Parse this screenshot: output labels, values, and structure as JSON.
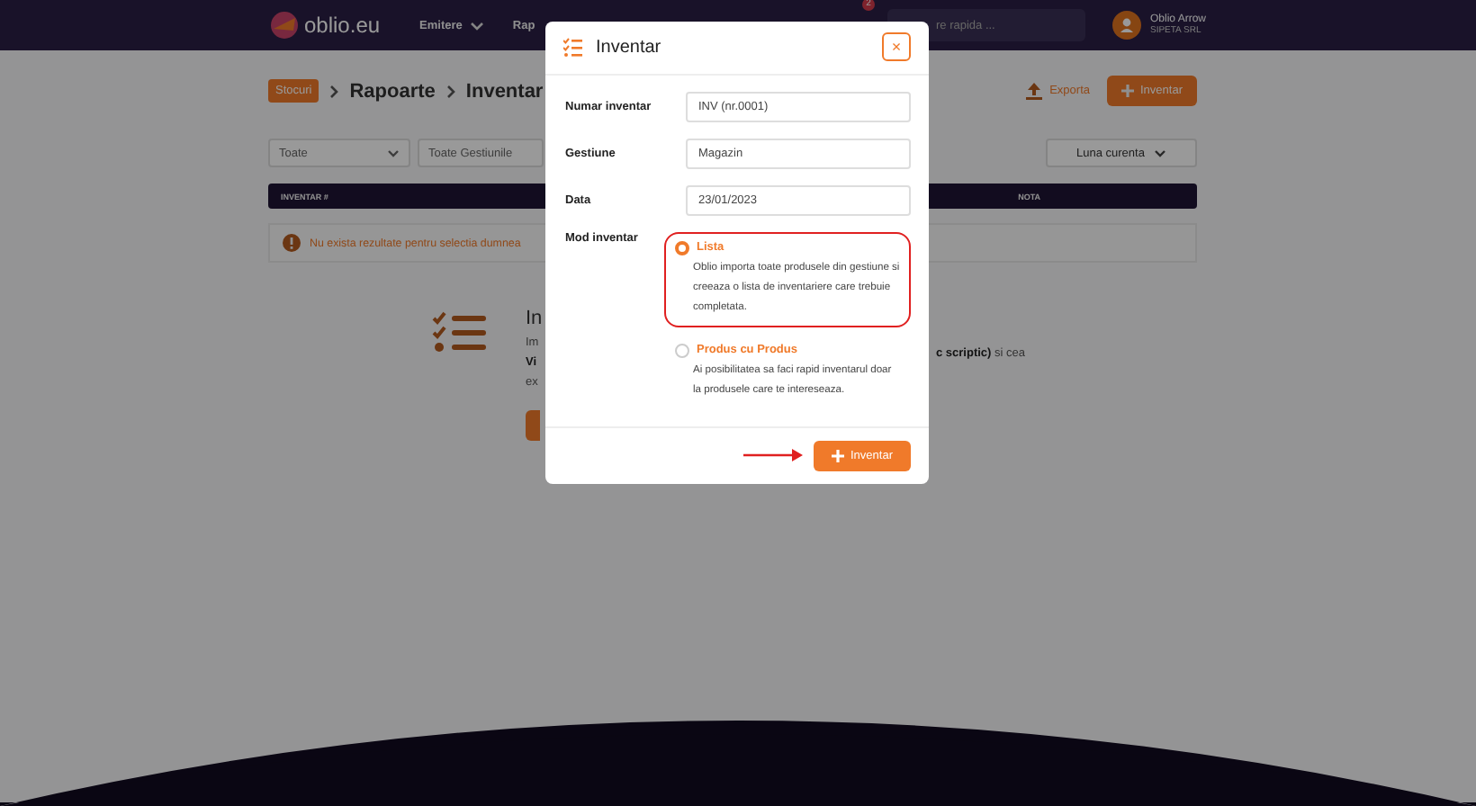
{
  "topbar": {
    "logo": "oblio.eu",
    "menu": [
      {
        "label": "Emitere",
        "caret": true
      },
      {
        "label": "Rap",
        "caret": false
      }
    ],
    "notification_count": "2",
    "search": {
      "placeholder": "re rapida ..."
    },
    "user": {
      "name": "Oblio Arrow",
      "company": "SIPETA SRL"
    }
  },
  "breadcrumb": {
    "tag": "Stocuri",
    "items": [
      "Rapoarte",
      "Inventar"
    ]
  },
  "actions": {
    "export": "Exporta",
    "add": "Inventar"
  },
  "filters": {
    "selects": [
      "Toate",
      "Toate Gestiunile"
    ],
    "period": "Luna curenta"
  },
  "table": {
    "columns": [
      "INVENTAR #",
      "NOTA"
    ]
  },
  "alert": {
    "text": "Nu exista rezultate pentru selectia dumnea"
  },
  "empty_state": {
    "title": "In",
    "lines": [
      "Im",
      "Vi",
      "ex"
    ],
    "right_text": "**c scriptic)** si cea"
  },
  "modal": {
    "title": "Inventar",
    "close": "×",
    "fields": [
      {
        "label": "Numar inventar",
        "value": "INV (nr.0001)"
      },
      {
        "label": "Gestiune",
        "value": "Magazin"
      },
      {
        "label": "Data",
        "value": "23/01/2023"
      }
    ],
    "mode_label": "Mod inventar",
    "options": [
      {
        "label": "Lista",
        "description": "Oblio importa toate produsele din gestiune si creeaza o lista de inventariere care trebuie completata.",
        "selected": true,
        "highlighted": true
      },
      {
        "label": "Produs cu Produs",
        "description": "Ai posibilitatea sa faci rapid inventarul doar la produsele care te intereseaza.",
        "selected": false,
        "highlighted": false
      }
    ],
    "submit": {
      "label": "Inventar",
      "arrow": true
    }
  }
}
